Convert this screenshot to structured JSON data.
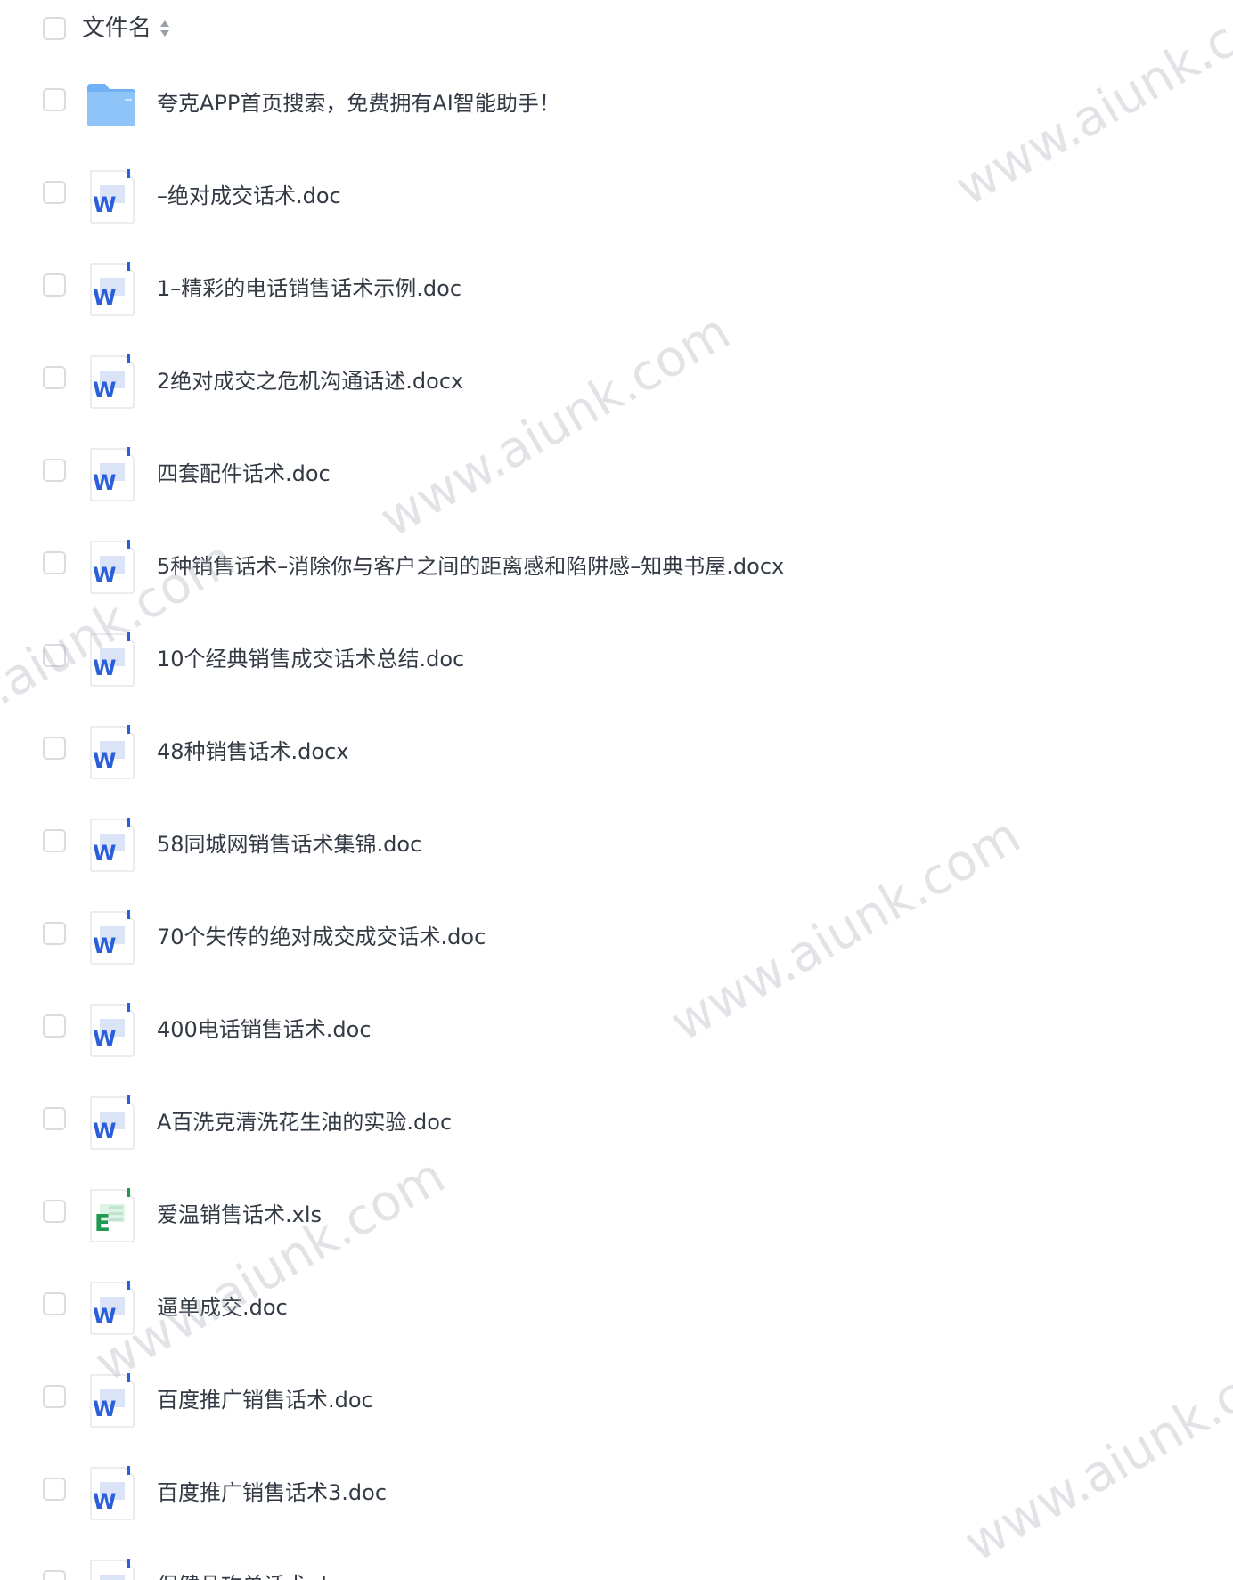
{
  "header": {
    "column_label": "文件名",
    "sort_icon": "sort-updown-icon"
  },
  "files": [
    {
      "name": "夸克APP首页搜索，免费拥有AI智能助手！",
      "type": "folder",
      "icon": "folder-icon"
    },
    {
      "name": "–绝对成交话术.doc",
      "type": "word",
      "icon": "word-doc-icon"
    },
    {
      "name": "1–精彩的电话销售话术示例.doc",
      "type": "word",
      "icon": "word-doc-icon"
    },
    {
      "name": "2绝对成交之危机沟通话述.docx",
      "type": "word",
      "icon": "word-doc-icon"
    },
    {
      "name": "四套配件话术.doc",
      "type": "word",
      "icon": "word-doc-icon"
    },
    {
      "name": "5种销售话术–消除你与客户之间的距离感和陷阱感–知典书屋.docx",
      "type": "word",
      "icon": "word-doc-icon"
    },
    {
      "name": "10个经典销售成交话术总结.doc",
      "type": "word",
      "icon": "word-doc-icon"
    },
    {
      "name": "48种销售话术.docx",
      "type": "word",
      "icon": "word-doc-icon"
    },
    {
      "name": "58同城网销售话术集锦.doc",
      "type": "word",
      "icon": "word-doc-icon"
    },
    {
      "name": "70个失传的绝对成交成交话术.doc",
      "type": "word",
      "icon": "word-doc-icon"
    },
    {
      "name": "400电话销售话术.doc",
      "type": "word",
      "icon": "word-doc-icon"
    },
    {
      "name": "A百洗克清洗花生油的实验.doc",
      "type": "word",
      "icon": "word-doc-icon"
    },
    {
      "name": "爱温销售话术.xls",
      "type": "excel",
      "icon": "excel-doc-icon"
    },
    {
      "name": "逼单成交.doc",
      "type": "word",
      "icon": "word-doc-icon"
    },
    {
      "name": "百度推广销售话术.doc",
      "type": "word",
      "icon": "word-doc-icon"
    },
    {
      "name": "百度推广销售话术3.doc",
      "type": "word",
      "icon": "word-doc-icon"
    },
    {
      "name": "保健品攻单话术.doc",
      "type": "word",
      "icon": "word-doc-icon"
    }
  ],
  "watermark_text": "www.aiunk.com",
  "colors": {
    "text": "#333a44",
    "checkbox_border": "#d9dbe0",
    "word_blue": "#2b5fd9",
    "excel_green": "#1f9a52",
    "folder_blue": "#6fb2f5"
  }
}
